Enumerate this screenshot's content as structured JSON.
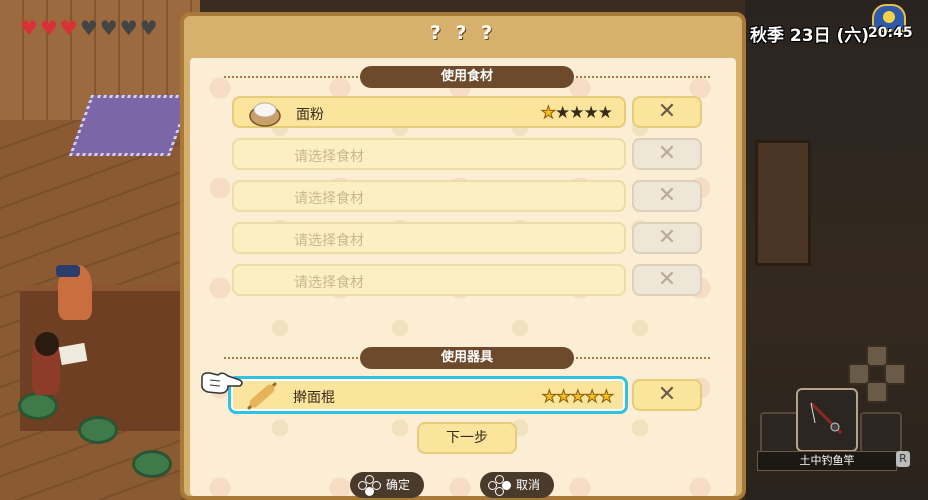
{
  "hud": {
    "hearts": [
      "full",
      "full",
      "full",
      "empty",
      "empty",
      "empty",
      "empty"
    ],
    "date": "秋季 23日 (六)",
    "time": "20:45",
    "weather_icon": "night-weather-icon",
    "equipped_tool": "土中钓鱼竿",
    "r_button": "R"
  },
  "dialog": {
    "title": "? ? ?",
    "ingredients_header": "使用食材",
    "ingredients": [
      {
        "label": "面粉",
        "filled": true,
        "icon": "flour-bag-icon",
        "stars_rating": 0.5,
        "stars_total": 5
      },
      {
        "label": "请选择食材",
        "filled": false
      },
      {
        "label": "请选择食材",
        "filled": false
      },
      {
        "label": "请选择食材",
        "filled": false
      },
      {
        "label": "请选择食材",
        "filled": false
      }
    ],
    "tools_header": "使用器具",
    "tool": {
      "label": "擀面棍",
      "icon": "rolling-pin-icon",
      "stars_rating": 5,
      "stars_total": 5
    },
    "remove_label": "✕",
    "next_button": "下一步",
    "confirm_label": "确定",
    "cancel_label": "取消"
  },
  "colors": {
    "selection": "#2ec3e0",
    "dialog_frame": "#a87938",
    "pill": "#6e4a2c"
  }
}
